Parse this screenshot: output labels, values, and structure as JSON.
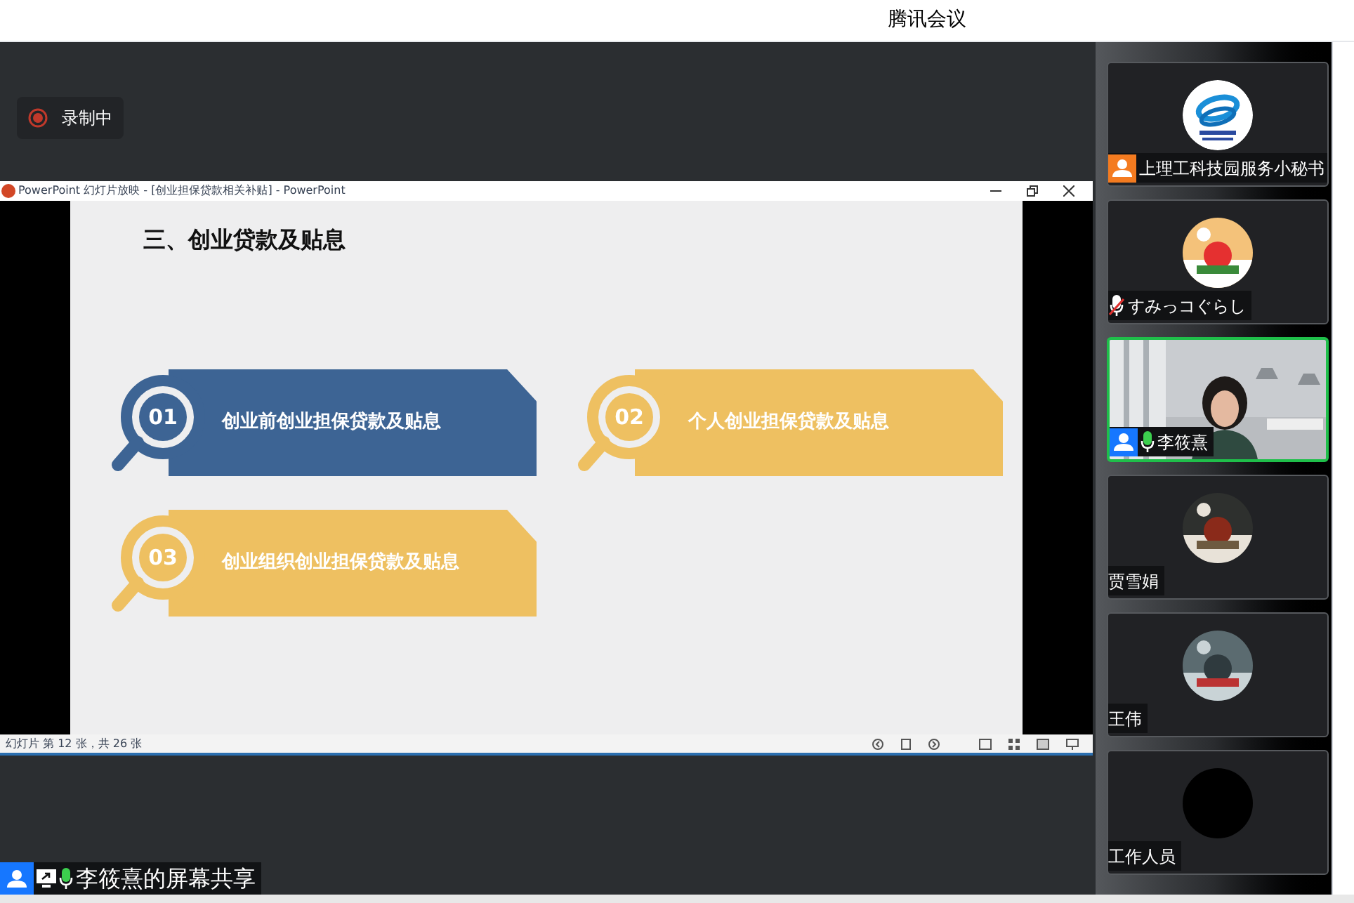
{
  "window": {
    "title": "腾讯会议"
  },
  "recording": {
    "label": "录制中"
  },
  "presentation": {
    "title": "PowerPoint 幻灯片放映 - [创业担保贷款相关补贴] - PowerPoint",
    "slide": {
      "heading": "三、创业贷款及贴息",
      "items": [
        {
          "number": "01",
          "label": "创业前创业担保贷款及贴息",
          "color": "#3d6494"
        },
        {
          "number": "02",
          "label": "个人创业担保贷款及贴息",
          "color": "#eec061"
        },
        {
          "number": "03",
          "label": "创业组织创业担保贷款及贴息",
          "color": "#eec061"
        }
      ]
    },
    "status": "幻灯片 第 12 张，共 26 张"
  },
  "participants": [
    {
      "name": "上理工科技园服务小秘书",
      "color": "#f47b20",
      "speaking": false,
      "kind": "logo"
    },
    {
      "name": "すみっコぐらし",
      "muted": true,
      "speaking": false,
      "kind": "picture"
    },
    {
      "name": "李筱熹",
      "color": "#1677ff",
      "muted": false,
      "speaking": true,
      "kind": "video"
    },
    {
      "name": "贾雪娟",
      "speaking": false,
      "kind": "picture"
    },
    {
      "name": "王伟",
      "speaking": false,
      "kind": "picture"
    },
    {
      "name": "工作人员",
      "speaking": false,
      "kind": "blank"
    }
  ],
  "share_label": {
    "text": "李筱熹的屏幕共享",
    "color": "#1677ff",
    "muted": false
  }
}
